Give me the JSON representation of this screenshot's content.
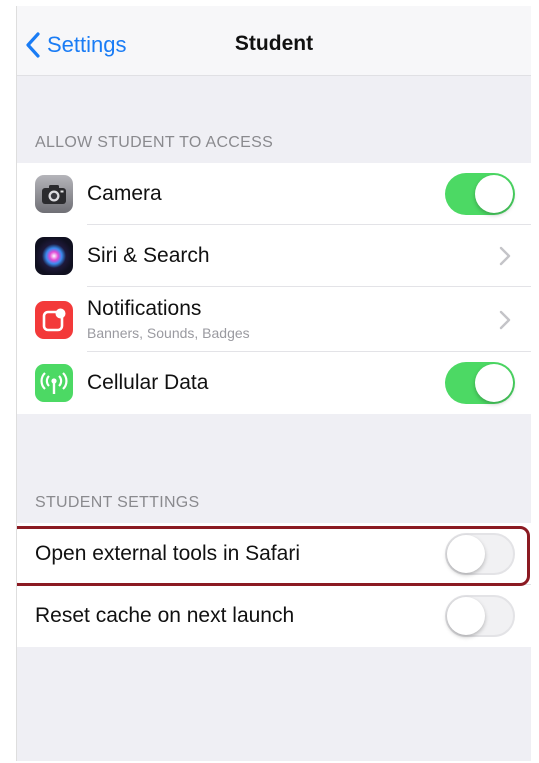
{
  "navbar": {
    "back_label": "Settings",
    "title": "Student"
  },
  "access_section": {
    "header": "ALLOW STUDENT TO ACCESS",
    "items": [
      {
        "label": "Camera",
        "icon": "camera-icon",
        "control": "toggle",
        "state": "on",
        "icon_color": "#8e8e93"
      },
      {
        "label": "Siri & Search",
        "icon": "siri-icon",
        "control": "chevron",
        "icon_color": "#1c1c3a"
      },
      {
        "label": "Notifications",
        "sublabel": "Banners, Sounds, Badges",
        "icon": "notifications-icon",
        "control": "chevron",
        "icon_color": "#f33a3a"
      },
      {
        "label": "Cellular Data",
        "icon": "antenna-icon",
        "control": "toggle",
        "state": "on",
        "icon_color": "#4cd964"
      }
    ]
  },
  "student_settings": {
    "header": "STUDENT SETTINGS",
    "items": [
      {
        "label": "Open external tools in Safari",
        "control": "toggle",
        "state": "off",
        "highlighted": true
      },
      {
        "label": "Reset cache on next launch",
        "control": "toggle",
        "state": "off"
      }
    ]
  },
  "colors": {
    "accent": "#1a7cf5",
    "toggle_on": "#4cd964",
    "highlight_border": "#8b1a22"
  }
}
